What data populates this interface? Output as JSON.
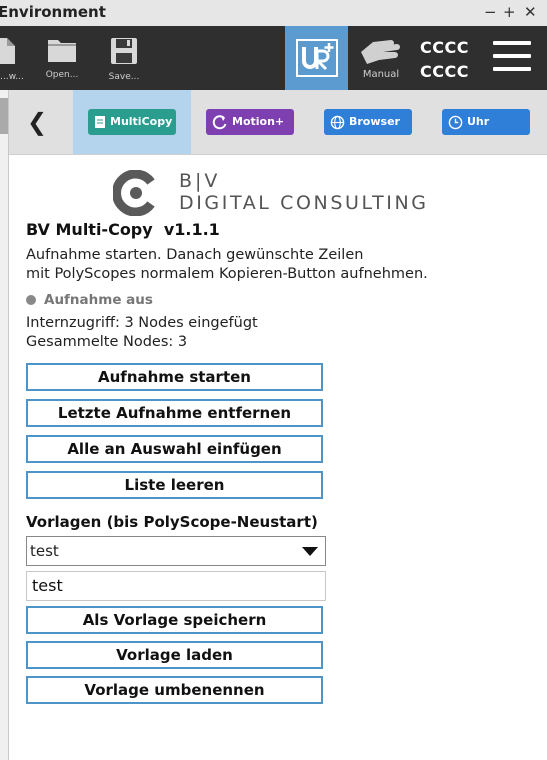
{
  "window": {
    "title": "Environment",
    "controls": [
      "−",
      "+",
      "✕"
    ]
  },
  "header": {
    "buttons": [
      {
        "label": "...w...",
        "icon": "new-file-icon"
      },
      {
        "label": "Open...",
        "icon": "folder-icon"
      },
      {
        "label": "Save...",
        "icon": "save-icon"
      }
    ],
    "urplus_icon": "ur-plus-icon",
    "manual_label": "Manual",
    "robot_name_top": "CCCC",
    "robot_name_bottom": "CCCC",
    "menu_icon": "hamburger-icon"
  },
  "tabs": [
    {
      "label": "MultiCopy",
      "color": "#2a9d8f",
      "icon": "document-icon"
    },
    {
      "label": "Motion+",
      "color": "#7e3fb0",
      "icon": "rotate-icon"
    },
    {
      "label": "Browser",
      "color": "#2f7ed8",
      "icon": "globe-icon"
    },
    {
      "label": "Uhr",
      "color": "#2f7ed8",
      "icon": "clock-icon"
    }
  ],
  "logo": {
    "line1": "B|V",
    "line2": "DIGITAL CONSULTING"
  },
  "content": {
    "heading": "BV Multi-Copy  v1.1.1",
    "intro_line1": "Aufnahme starten. Danach gewünschte Zeilen",
    "intro_line2": "mit PolyScopes normalem Kopieren-Button aufnehmen.",
    "status": "Aufnahme aus",
    "internal_access": "Internzugriff: 3 Nodes eingefügt",
    "collected_nodes": "Gesammelte Nodes: 3",
    "buttons": {
      "start": "Aufnahme starten",
      "remove_last": "Letzte Aufnahme entfernen",
      "insert_all": "Alle an Auswahl einfügen",
      "clear_list": "Liste leeren"
    },
    "templates_label": "Vorlagen (bis PolyScope-Neustart)",
    "template_select_value": "test",
    "template_name_value": "test",
    "template_buttons": {
      "save": "Als Vorlage speichern",
      "load": "Vorlage laden",
      "rename": "Vorlage umbenennen"
    }
  }
}
